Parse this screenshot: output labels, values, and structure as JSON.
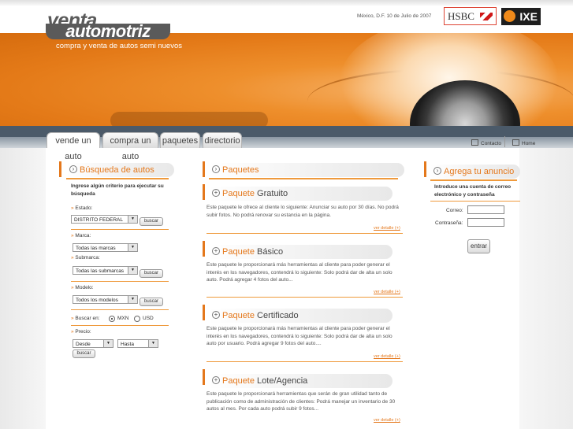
{
  "brand": {
    "logo_line1": "venta",
    "logo_line2": "automotriz",
    "tagline": "compra y venta de autos semi nuevos"
  },
  "header": {
    "date": "México, D.F. 10 de Julio de 2007",
    "sponsor1": "HSBC",
    "sponsor2": "IXE"
  },
  "nav": {
    "tabs": [
      "vende un auto",
      "compra un auto",
      "paquetes",
      "directorio"
    ],
    "contacto": "Contacto",
    "home": "Home"
  },
  "search": {
    "title_prefix": "Búsqueda de autos",
    "intro": "Ingrese algún criterio para ejecutar su búsqueda",
    "estado_label": "Estado:",
    "estado_value": "DISTRITO FEDERAL",
    "marca_label": "Marca:",
    "marca_value": "Todas las marcas",
    "submarca_label": "Submarca:",
    "submarca_value": "Todas las submarcas",
    "modelo_label": "Modelo:",
    "modelo_value": "Todos los modelos",
    "buscar_en_label": "Buscar en:",
    "currency_mxn": "MXN",
    "currency_usd": "USD",
    "currency_selected": "MXN",
    "precio_label": "Precio:",
    "desde_value": "Desde",
    "hasta_value": "Hasta",
    "button": "buscar"
  },
  "paquetes": {
    "title": "Paquetes",
    "items": [
      {
        "prefix": "Paquete",
        "name": "Gratuito",
        "text": "Este paquete le ofrece al cliente lo siguiente: Anunciar su auto por 30 días. No podrá subir fotos. No podrá renovar su estancia en la página.",
        "link": "ver detalle (+)"
      },
      {
        "prefix": "Paquete",
        "name": "Básico",
        "text": "Este paquete le proporcionará más herramientas al cliente para poder generar el interés en los navegadores, contendrá lo siguiente: Solo podrá dar de alta un solo auto. Podrá agregar 4 fotos del auto...",
        "link": "ver detalle (+)"
      },
      {
        "prefix": "Paquete",
        "name": "Certificado",
        "text": "Este paquete le proporcionará más herramientas al cliente para poder generar el interés en los navegadores, contendrá lo siguiente: Solo podrá dar de alta un solo auto por usuario. Podrá agregar 9 fotos del auto....",
        "link": "ver detalle (+)"
      },
      {
        "prefix": "Paquete",
        "name": "Lote/Agencia",
        "text": "Este paquete le proporcionará herramientas que serán de gran utilidad tanto de publicación como de administración de clientes: Podrá manejar un inventario de 30 autos al mes. Por cada auto podrá subir 9 fotos...",
        "link": "ver detalle (+)"
      }
    ]
  },
  "anuncio": {
    "title": "Agrega tu anuncio",
    "intro": "Introduce una cuenta de correo electrónico y contraseña",
    "correo_label": "Correo:",
    "pass_label": "Contraseña:",
    "button": "entrar"
  }
}
